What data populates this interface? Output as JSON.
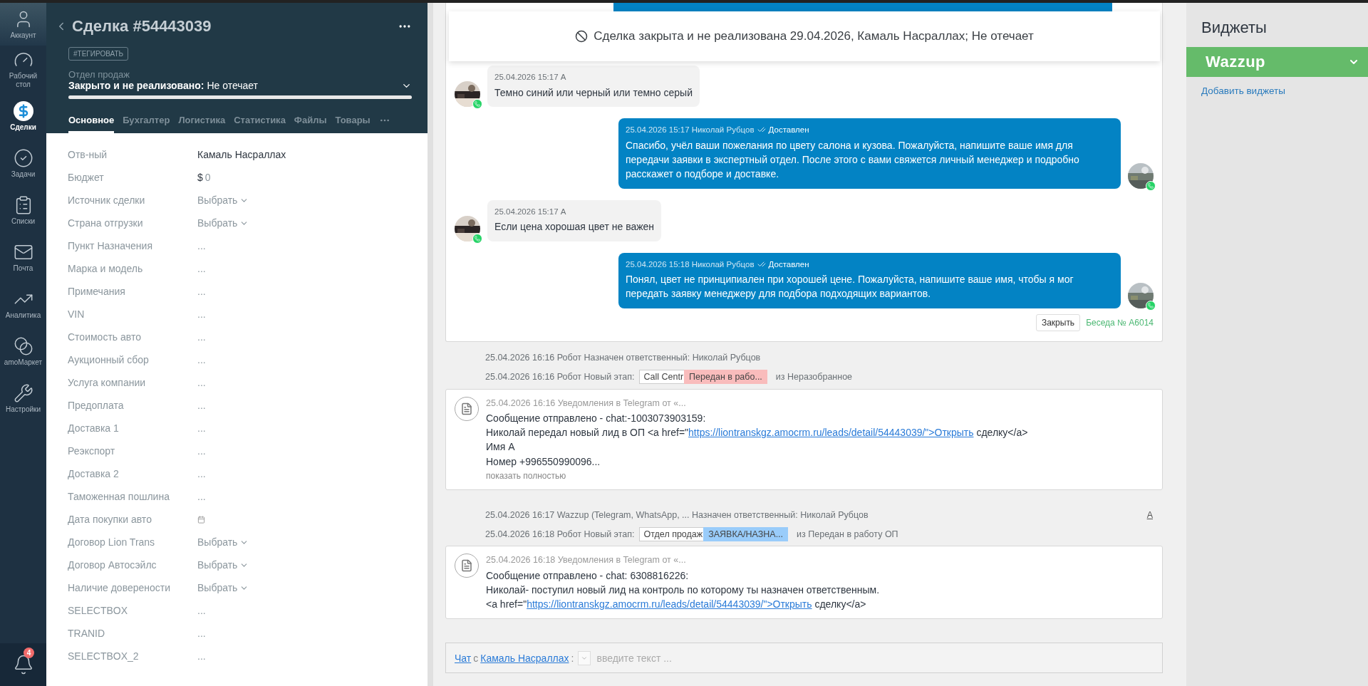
{
  "nav": {
    "items": [
      {
        "label": "Аккаунт",
        "selected": false
      },
      {
        "label": "Рабочий стол",
        "selected": false
      },
      {
        "label": "Сделки",
        "selected": true
      },
      {
        "label": "Задачи",
        "selected": false
      },
      {
        "label": "Списки",
        "selected": false
      },
      {
        "label": "Почта",
        "selected": false
      },
      {
        "label": "Аналитика",
        "selected": false
      },
      {
        "label": "amoМаркет",
        "selected": false
      },
      {
        "label": "Настройки",
        "selected": false
      }
    ],
    "notifications": {
      "badge": "4"
    }
  },
  "deal": {
    "title": "Сделка #54443039",
    "tag_button": "#ТЕГИРОВАТЬ",
    "pipeline": "Отдел продаж",
    "stage": "Закрыто и не реализовано:",
    "reason": "Не отечает",
    "progress": {
      "level": 1
    },
    "tabs": [
      {
        "label": "Основное",
        "selected": true
      },
      {
        "label": "Бухгалтер",
        "selected": false
      },
      {
        "label": "Логистика",
        "selected": false
      },
      {
        "label": "Статистика",
        "selected": false
      },
      {
        "label": "Файлы",
        "selected": false
      },
      {
        "label": "Товары",
        "selected": false
      }
    ]
  },
  "fields": [
    {
      "label": "Отв-ный",
      "kind": "text",
      "value": "Камаль Насраллах"
    },
    {
      "label": "Бюджет",
      "kind": "budget",
      "currency": "$",
      "value": "0"
    },
    {
      "label": "Источник сделки",
      "kind": "select",
      "value": "Выбрать"
    },
    {
      "label": "Страна отгрузки",
      "kind": "select",
      "value": "Выбрать"
    },
    {
      "label": "Пункт Назначения",
      "kind": "empty",
      "value": "..."
    },
    {
      "label": "Марка и модель",
      "kind": "empty",
      "value": "..."
    },
    {
      "label": "Примечания",
      "kind": "empty",
      "value": "..."
    },
    {
      "label": "VIN",
      "kind": "empty",
      "value": "..."
    },
    {
      "label": "Стоимость авто",
      "kind": "empty",
      "value": "..."
    },
    {
      "label": "Аукционный сбор",
      "kind": "empty",
      "value": "..."
    },
    {
      "label": "Услуга компании",
      "kind": "empty",
      "value": "..."
    },
    {
      "label": "Предоплата",
      "kind": "empty",
      "value": "..."
    },
    {
      "label": "Доставка 1",
      "kind": "empty",
      "value": "..."
    },
    {
      "label": "Реэкспорт",
      "kind": "empty",
      "value": "..."
    },
    {
      "label": "Доставка 2",
      "kind": "empty",
      "value": "..."
    },
    {
      "label": "Таможенная пошлина",
      "kind": "empty",
      "value": "..."
    },
    {
      "label": "Дата покупки авто",
      "kind": "date"
    },
    {
      "label": "Договор Lion Trans",
      "kind": "select",
      "value": "Выбрать"
    },
    {
      "label": "Договор Автосэйлс",
      "kind": "select",
      "value": "Выбрать"
    },
    {
      "label": "Наличие доверености",
      "kind": "select",
      "value": "Выбрать"
    },
    {
      "label": "SELECTBOX",
      "kind": "empty",
      "value": "..."
    },
    {
      "label": "TRANID",
      "kind": "empty",
      "value": "..."
    },
    {
      "label": "SELECTBOX_2",
      "kind": "empty",
      "value": "..."
    }
  ],
  "banner": {
    "text": "Сделка закрыта и не реализована 29.04.2026, Камаль Насраллах; Не отечает"
  },
  "chat": {
    "messages": [
      {
        "kind": "incoming",
        "meta": "25.04.2026 15:17 А",
        "text": "Темно синий или черный или темно серый"
      },
      {
        "kind": "outgoing",
        "meta": "25.04.2026 15:17 Николай Рубцов",
        "status": "Доставлен",
        "text": "Спасибо, учёл ваши пожелания по цвету салона и кузова. Пожалуйста, напишите ваше имя для передачи заявки в экспертный отдел. После этого с вами свяжется личный менеджер и подробно расскажет о подборе и доставке."
      },
      {
        "kind": "incoming",
        "meta": "25.04.2026 15:17 А",
        "text": "Если цена хорошая цвет не важен"
      },
      {
        "kind": "outgoing",
        "meta": "25.04.2026 15:18 Николай Рубцов",
        "status": "Доставлен",
        "text": "Понял, цвет не принципиален при хорошей цене. Пожалуйста, напишите ваше имя, чтобы я мог передать заявку менеджеру для подбора подходящих вариантов."
      }
    ],
    "close_button": "Закрыть",
    "conversation": "Беседа № А6014"
  },
  "feed": [
    {
      "kind": "event",
      "text": "25.04.2026 16:16 Робот Назначен ответственный: Николай Рубцов"
    },
    {
      "kind": "event",
      "text": "25.04.2026 16:16 Робот Новый этап:",
      "stages": [
        {
          "label": "Call Centr",
          "color": "#ffffff"
        },
        {
          "label": "Передан в рабо...",
          "color": "#f9bcbc"
        }
      ],
      "suffix": "из Неразобранное"
    },
    {
      "kind": "note",
      "meta": "25.04.2026 16:16 Уведомления в Telegram от «...",
      "lines": [
        {
          "text": "Сообщение отправлено - chat:-1003073903159:"
        },
        {
          "text": "Николай передал новый лид в ОП <a href=\"",
          "link": "https://liontranskgz.amocrm.ru/leads/detail/54443039/\">Открыть",
          "after": " сделку</a>"
        },
        {
          "text": "Имя А"
        },
        {
          "text": "Номер +996550990096..."
        }
      ],
      "more": "показать полностью"
    },
    {
      "kind": "event",
      "text": "25.04.2026 16:17 Wazzup (Telegram, WhatsApp, ... Назначен ответственный: Николай Рубцов",
      "link": "А"
    },
    {
      "kind": "event",
      "text": "25.04.2026 16:18 Робот Новый этап:",
      "stages": [
        {
          "label": "Отдел продаж",
          "color": "#ffffff"
        },
        {
          "label": "ЗАЯВКА/НАЗНА...",
          "color": "#99ccfa"
        }
      ],
      "suffix": "из Передан в работу ОП"
    },
    {
      "kind": "note",
      "meta": "25.04.2026 16:18 Уведомления в Telegram от «...",
      "lines": [
        {
          "text": "Сообщение отправлено - chat: 6308816226:"
        },
        {
          "text": "Николай- поступил новый лид на контроль по которому ты назначен ответственным."
        },
        {
          "text": "<a href=\"",
          "link": "https://liontranskgz.amocrm.ru/leads/detail/54443039/\">Открыть",
          "after": " сделку</a>"
        }
      ]
    }
  ],
  "composer": {
    "chat_link": "Чат",
    "with": "с",
    "contact_link": "Камаль Насраллах",
    "colon": ":",
    "placeholder": "введите текст ..."
  },
  "widgets": {
    "title": "Виджеты",
    "items": [
      {
        "label": "Wazzup"
      }
    ],
    "add_link": "Добавить виджеты"
  }
}
